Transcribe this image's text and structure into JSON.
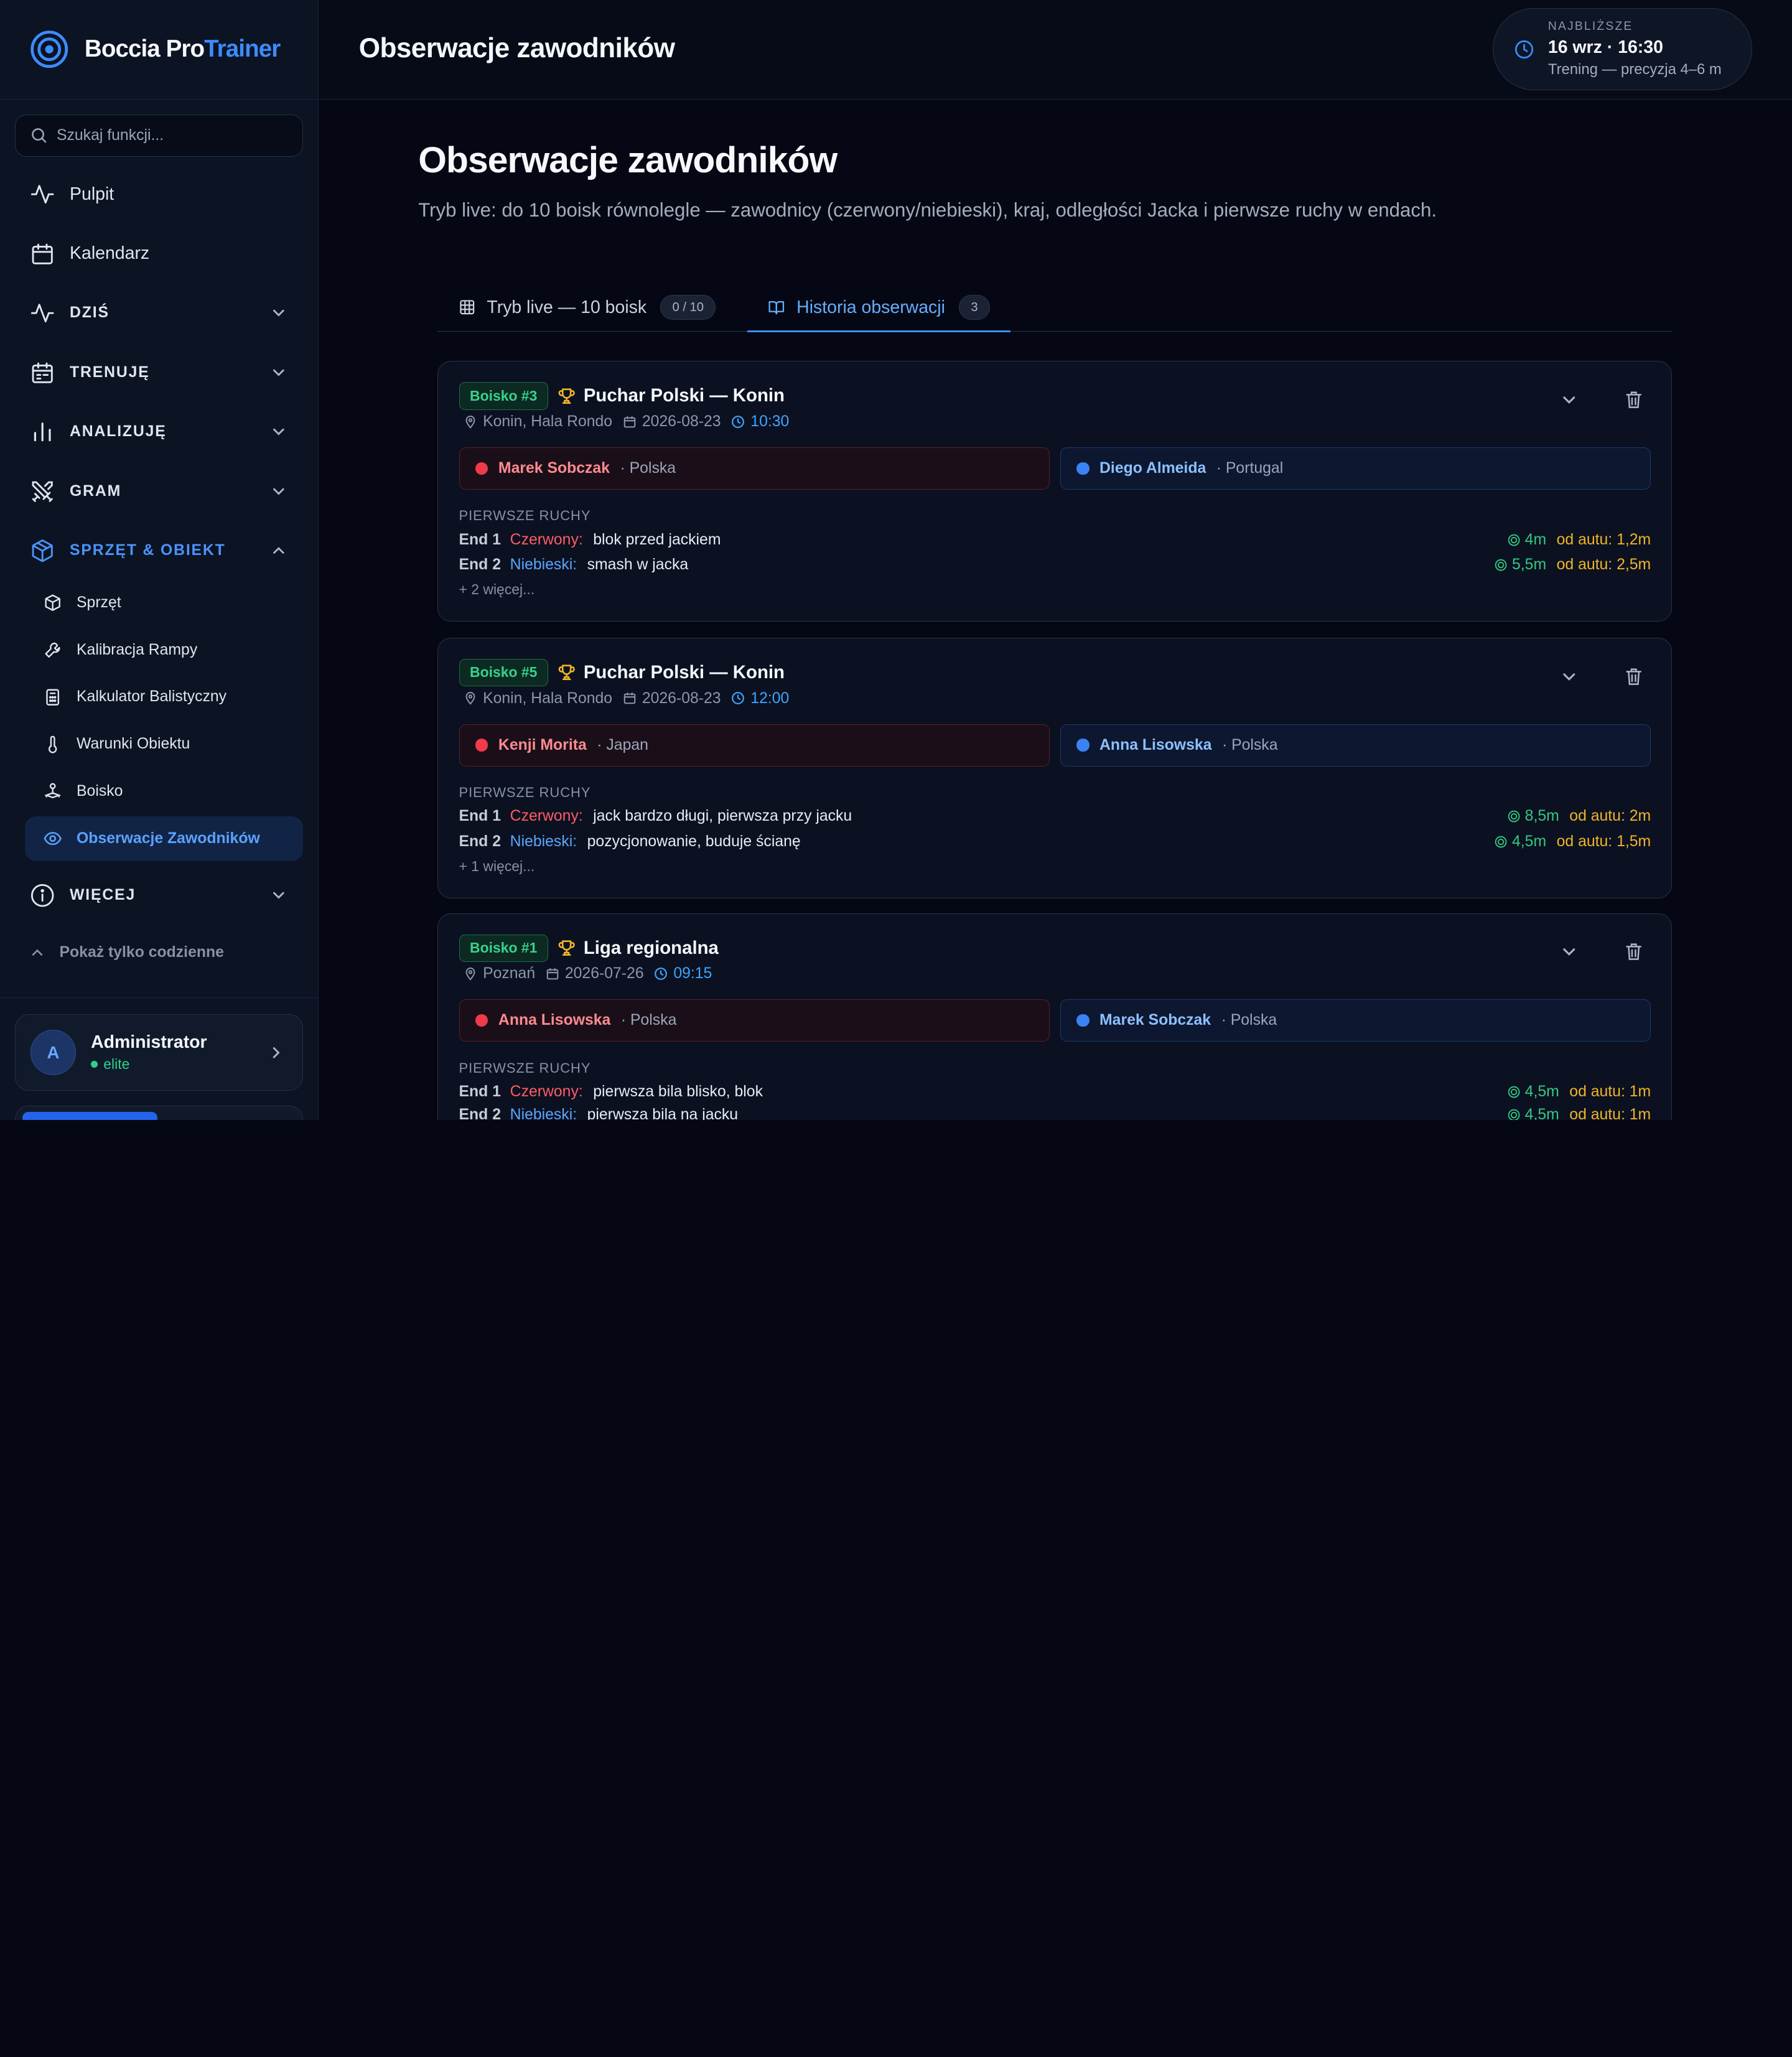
{
  "brand": {
    "name_a": "Boccia Pro",
    "name_b": "Trainer",
    "accent": "#3b8cff"
  },
  "search": {
    "placeholder": "Szukaj funkcji..."
  },
  "nav": {
    "items": [
      {
        "label": "Pulpit",
        "icon": "activity-icon"
      },
      {
        "label": "Kalendarz",
        "icon": "calendar-icon"
      },
      {
        "label": "DZIŚ",
        "icon": "pulse-icon"
      },
      {
        "label": "TRENUJĘ",
        "icon": "calendar-check-icon"
      },
      {
        "label": "ANALIZUJĘ",
        "icon": "bar-chart-icon"
      },
      {
        "label": "GRAM",
        "icon": "swords-icon"
      },
      {
        "label": "SPRZĘT & OBIEKT",
        "icon": "box-icon"
      },
      {
        "label": "WIĘCEJ",
        "icon": "info-icon"
      }
    ],
    "sub_items": [
      {
        "label": "Sprzęt",
        "icon": "package-icon"
      },
      {
        "label": "Kalibracja Rampy",
        "icon": "wrench-icon"
      },
      {
        "label": "Kalkulator Balistyczny",
        "icon": "calculator-icon"
      },
      {
        "label": "Warunki Obiektu",
        "icon": "thermometer-icon"
      },
      {
        "label": "Boisko",
        "icon": "joystick-icon"
      },
      {
        "label": "Obserwacje Zawodników",
        "icon": "eye-icon"
      }
    ],
    "show_daily": "Pokaż tylko codzienne"
  },
  "user": {
    "initial": "A",
    "name": "Administrator",
    "role": "elite"
  },
  "header": {
    "title": "Obserwacje zawodników",
    "next_caption": "NAJBLIŻSZE",
    "next_when": "16 wrz · 16:30",
    "next_what": "Trening — precyzja 4–6 m"
  },
  "page": {
    "title": "Obserwacje zawodników",
    "subtitle": "Tryb live: do 10 boisk równolegle — zawodnicy (czerwony/niebieski), kraj, odległości Jacka i pierwsze ruchy w endach."
  },
  "tabs": [
    {
      "label": "Tryb live — 10 boisk",
      "badge": "0 / 10"
    },
    {
      "label": "Historia obserwacji",
      "badge": "3"
    }
  ],
  "cards": [
    {
      "court": "Boisko #3",
      "title": "Puchar Polski — Konin",
      "place": "Konin, Hala Rondo",
      "date": "2026-08-23",
      "time": "10:30",
      "red": {
        "name": "Marek Sobczak",
        "country": "· Polska"
      },
      "blue": {
        "name": "Diego Almeida",
        "country": "· Portugal"
      },
      "moves_caption": "PIERWSZE RUCHY",
      "moves": [
        {
          "end": "End 1",
          "side": "Czerwony:",
          "desc": "blok przed jackiem",
          "dist": "4m",
          "auto": "od autu: 1,2m"
        },
        {
          "end": "End 2",
          "side": "Niebieski:",
          "desc": "smash w jacka",
          "dist": "5,5m",
          "auto": "od autu: 2,5m"
        }
      ],
      "more": "+ 2 więcej..."
    },
    {
      "court": "Boisko #5",
      "title": "Puchar Polski — Konin",
      "place": "Konin, Hala Rondo",
      "date": "2026-08-23",
      "time": "12:00",
      "red": {
        "name": "Kenji Morita",
        "country": "· Japan"
      },
      "blue": {
        "name": "Anna Lisowska",
        "country": "· Polska"
      },
      "moves_caption": "PIERWSZE RUCHY",
      "moves": [
        {
          "end": "End 1",
          "side": "Czerwony:",
          "desc": "jack bardzo długi, pierwsza przy jacku",
          "dist": "8,5m",
          "auto": "od autu: 2m"
        },
        {
          "end": "End 2",
          "side": "Niebieski:",
          "desc": "pozycjonowanie, buduje ścianę",
          "dist": "4,5m",
          "auto": "od autu: 1,5m"
        }
      ],
      "more": "+ 1 więcej..."
    },
    {
      "court": "Boisko #1",
      "title": "Liga regionalna",
      "place": "Poznań",
      "date": "2026-07-26",
      "time": "09:15",
      "red": {
        "name": "Anna Lisowska",
        "country": "· Polska"
      },
      "blue": {
        "name": "Marek Sobczak",
        "country": "· Polska"
      },
      "moves_caption": "PIERWSZE RUCHY",
      "moves": [
        {
          "end": "End 1",
          "side": "Czerwony:",
          "desc": "pierwsza bila blisko, blok",
          "dist": "4,5m",
          "auto": "od autu: 1m"
        },
        {
          "end": "End 2",
          "side": "Niebieski:",
          "desc": "pierwsza bila na jacku",
          "dist": "4,5m",
          "auto": "od autu: 1m"
        }
      ],
      "more": ""
    }
  ]
}
